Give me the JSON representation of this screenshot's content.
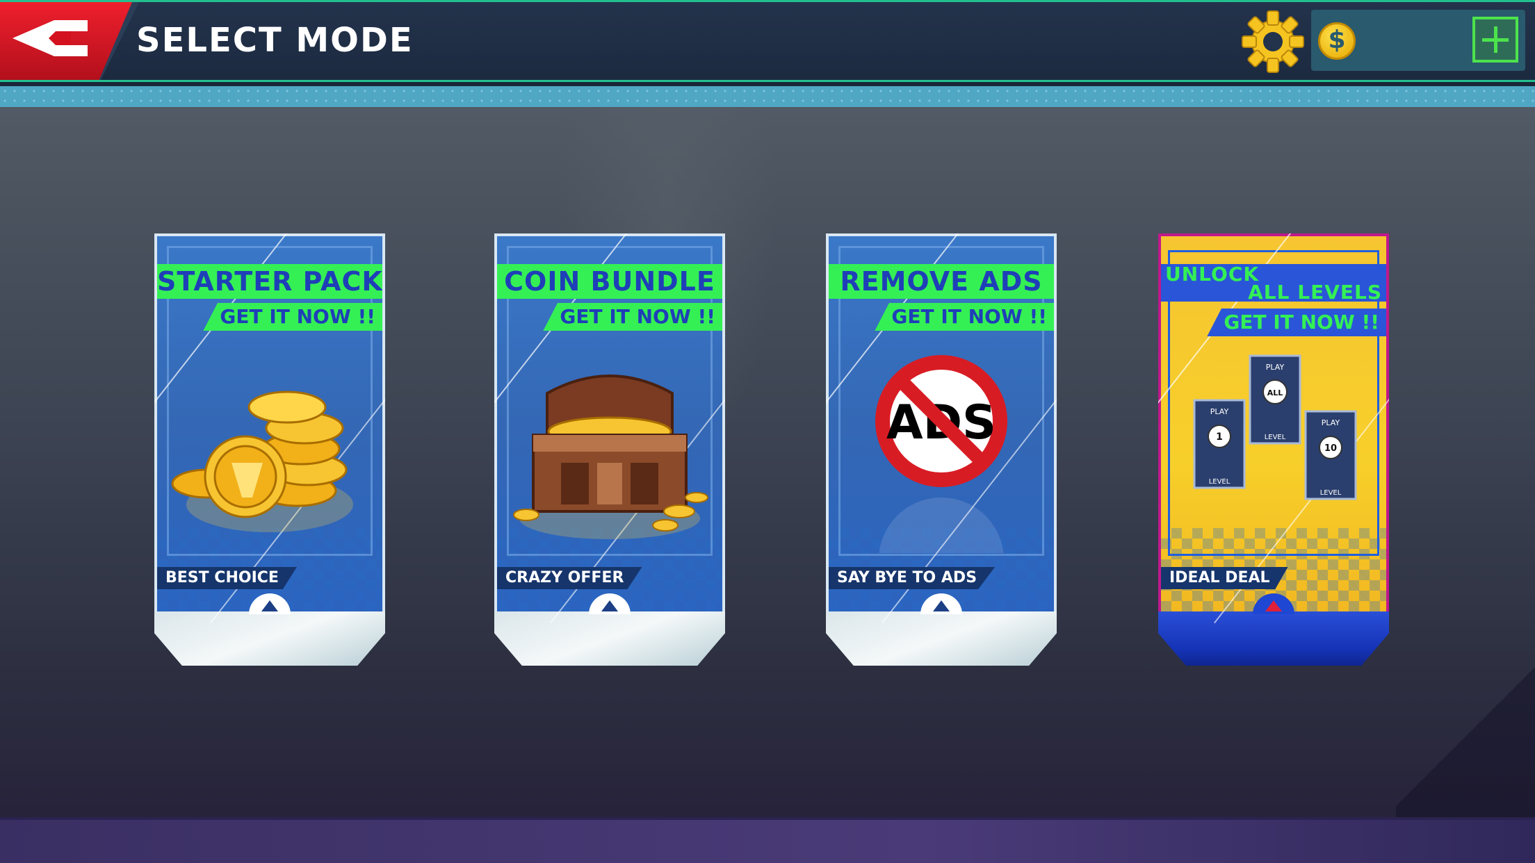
{
  "header": {
    "title": "SELECT MODE",
    "coins": ""
  },
  "offers": [
    {
      "name": "STARTER PACK",
      "cta": "GET IT NOW !!",
      "tag": "BEST CHOICE"
    },
    {
      "name": "COIN BUNDLE",
      "cta": "GET IT NOW !!",
      "tag": "CRAZY OFFER"
    },
    {
      "name": "REMOVE ADS",
      "cta": "GET IT NOW !!",
      "tag": "SAY BYE TO ADS",
      "icon_text": "ADS"
    },
    {
      "name_line1": "UNLOCK",
      "name_line2": "ALL LEVELS",
      "cta": "GET IT NOW !!",
      "tag": "IDEAL DEAL",
      "cards": [
        {
          "top": "PLAY",
          "value": "1",
          "bottom": "LEVEL"
        },
        {
          "top": "PLAY",
          "value": "ALL",
          "bottom": "LEVEL"
        },
        {
          "top": "PLAY",
          "value": "10",
          "bottom": "LEVEL"
        }
      ]
    }
  ],
  "colors": {
    "accent_green": "#34f055",
    "label_blue": "#1f3fb8",
    "back_red": "#ef1f2d",
    "gold": "#f6c531"
  },
  "icons": [
    "back-arrow-icon",
    "gear-icon",
    "coin-icon",
    "plus-icon"
  ]
}
